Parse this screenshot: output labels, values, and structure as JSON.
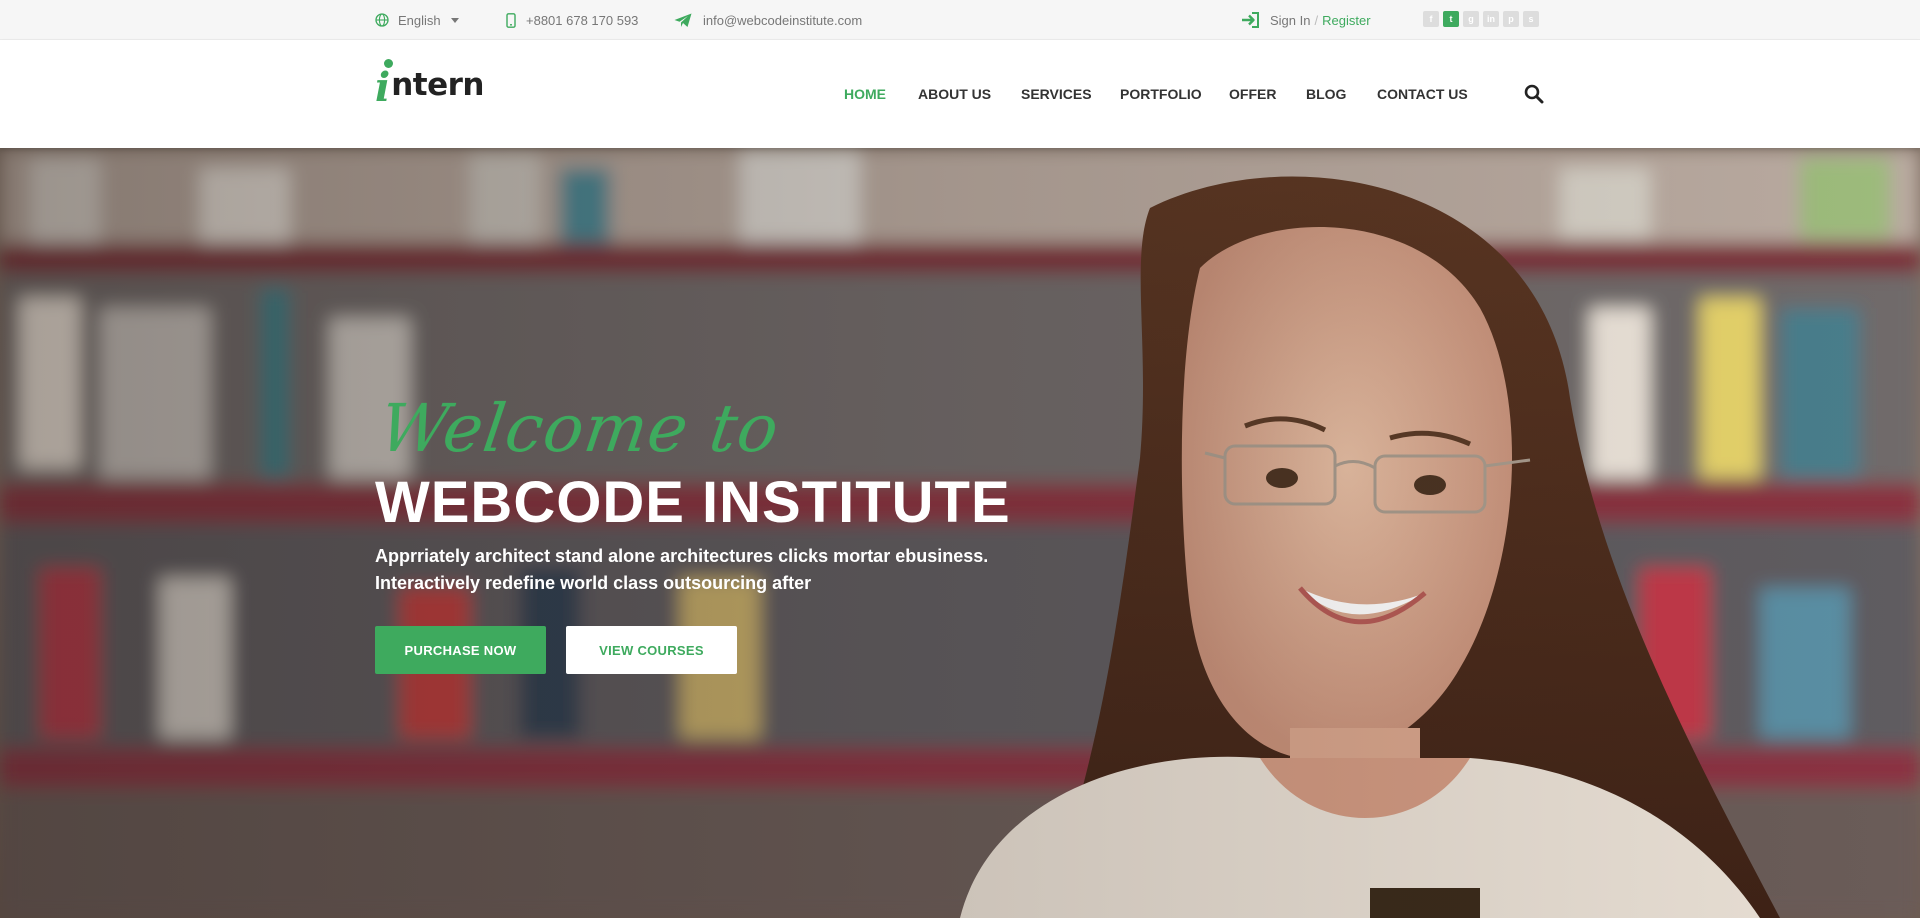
{
  "topbar": {
    "language": "English",
    "phone": "+8801 678 170 593",
    "email": "info@webcodeinstitute.com",
    "signin": "Sign In",
    "separator": "/",
    "register": "Register",
    "social": [
      {
        "icon": "facebook-icon",
        "glyph": "f"
      },
      {
        "icon": "twitter-icon",
        "glyph": "t"
      },
      {
        "icon": "google-plus-icon",
        "glyph": "g"
      },
      {
        "icon": "linkedin-icon",
        "glyph": "in"
      },
      {
        "icon": "pinterest-icon",
        "glyph": "p"
      },
      {
        "icon": "skype-icon",
        "glyph": "s"
      }
    ]
  },
  "brand": {
    "logo_letter": "i",
    "logo_rest": "ntern",
    "accent_color": "#3eaa5e"
  },
  "nav": {
    "items": [
      {
        "label": "HOME",
        "active": true
      },
      {
        "label": "ABOUT US",
        "active": false
      },
      {
        "label": "SERVICES",
        "active": false
      },
      {
        "label": "PORTFOLIO",
        "active": false
      },
      {
        "label": "OFFER",
        "active": false
      },
      {
        "label": "BLOG",
        "active": false
      },
      {
        "label": "CONTACT US",
        "active": false
      }
    ],
    "search_icon": "search-icon"
  },
  "hero": {
    "script_title": "Welcome to",
    "title": "WEBCODE INSTITUTE",
    "description": "Apprriately architect stand alone architectures clicks mortar ebusiness. Interactively redefine world class outsourcing after",
    "primary_button": "PURCHASE NOW",
    "secondary_button": "VIEW COURSES"
  }
}
